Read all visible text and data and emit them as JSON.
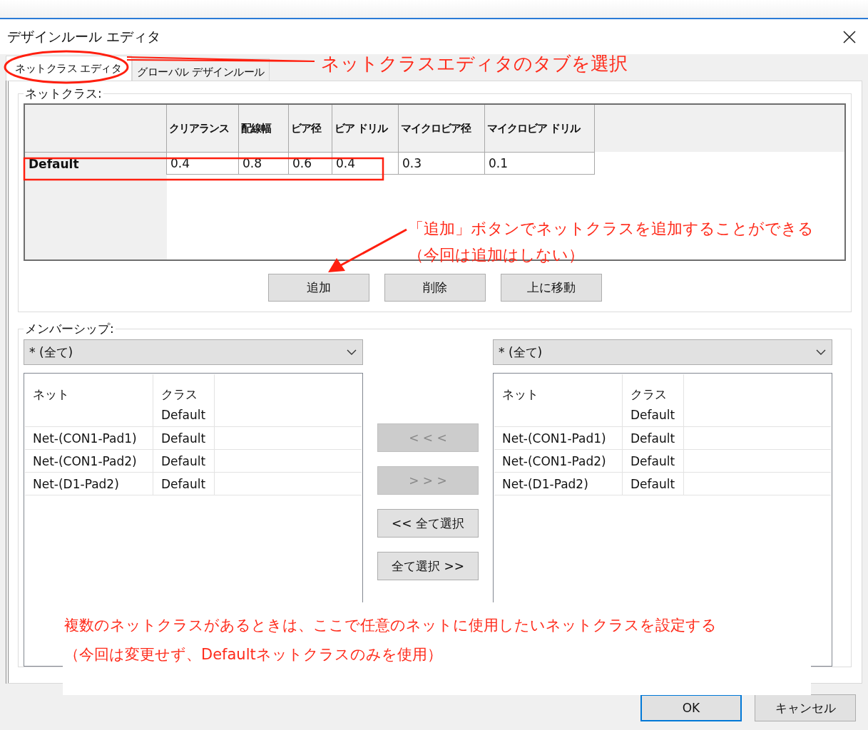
{
  "window": {
    "title": "デザインルール エディタ"
  },
  "tabs": [
    {
      "label": "ネットクラス エディタ",
      "selected": true
    },
    {
      "label": "グローバル デザインルール",
      "selected": false
    }
  ],
  "netclasses": {
    "legend": "ネットクラス:",
    "columns": [
      "クリアランス",
      "配線幅",
      "ビア径",
      "ビア ドリル",
      "マイクロビア径",
      "マイクロビア ドリル"
    ],
    "rows": [
      {
        "name": "Default",
        "values": [
          "0.4",
          "0.8",
          "0.6",
          "0.4",
          "0.3",
          "0.1"
        ]
      }
    ],
    "buttons": [
      "追加",
      "削除",
      "上に移動"
    ]
  },
  "membership": {
    "legend": "メンバーシップ:",
    "lists": [
      {
        "filter": "* (全て)",
        "columns": [
          "ネット",
          "クラス"
        ],
        "class_filter": "Default",
        "rows": [
          {
            "net": "Net-(CON1-Pad1)",
            "class": "Default"
          },
          {
            "net": "Net-(CON1-Pad2)",
            "class": "Default"
          },
          {
            "net": "Net-(D1-Pad2)",
            "class": "Default"
          }
        ]
      },
      {
        "filter": "* (全て)",
        "columns": [
          "ネット",
          "クラス"
        ],
        "class_filter": "Default",
        "rows": [
          {
            "net": "Net-(CON1-Pad1)",
            "class": "Default"
          },
          {
            "net": "Net-(CON1-Pad2)",
            "class": "Default"
          },
          {
            "net": "Net-(D1-Pad2)",
            "class": "Default"
          }
        ]
      }
    ],
    "transfer_buttons": [
      {
        "label": "< < <",
        "disabled": true
      },
      {
        "label": "> > >",
        "disabled": true
      },
      {
        "label": "<< 全て選択",
        "disabled": false
      },
      {
        "label": "全て選択 >>",
        "disabled": false
      }
    ]
  },
  "dialog_buttons": [
    {
      "label": "OK",
      "default": true
    },
    {
      "label": "キャンセル",
      "default": false
    }
  ],
  "annotations": [
    {
      "kind": "tab-callout",
      "lines": [
        "ネットクラスエディタのタブを選択"
      ]
    },
    {
      "kind": "row-highlight"
    },
    {
      "kind": "arrow-callout",
      "lines": [
        "「追加」ボタンでネットクラスを追加することができる",
        "（今回は追加はしない）"
      ]
    },
    {
      "kind": "note",
      "lines": [
        "複数のネットクラスがあるときは、ここで任意のネットに使用したいネットクラスを設定する",
        "（今回は変更せず、Defaultネットクラスのみを使用）"
      ]
    }
  ]
}
